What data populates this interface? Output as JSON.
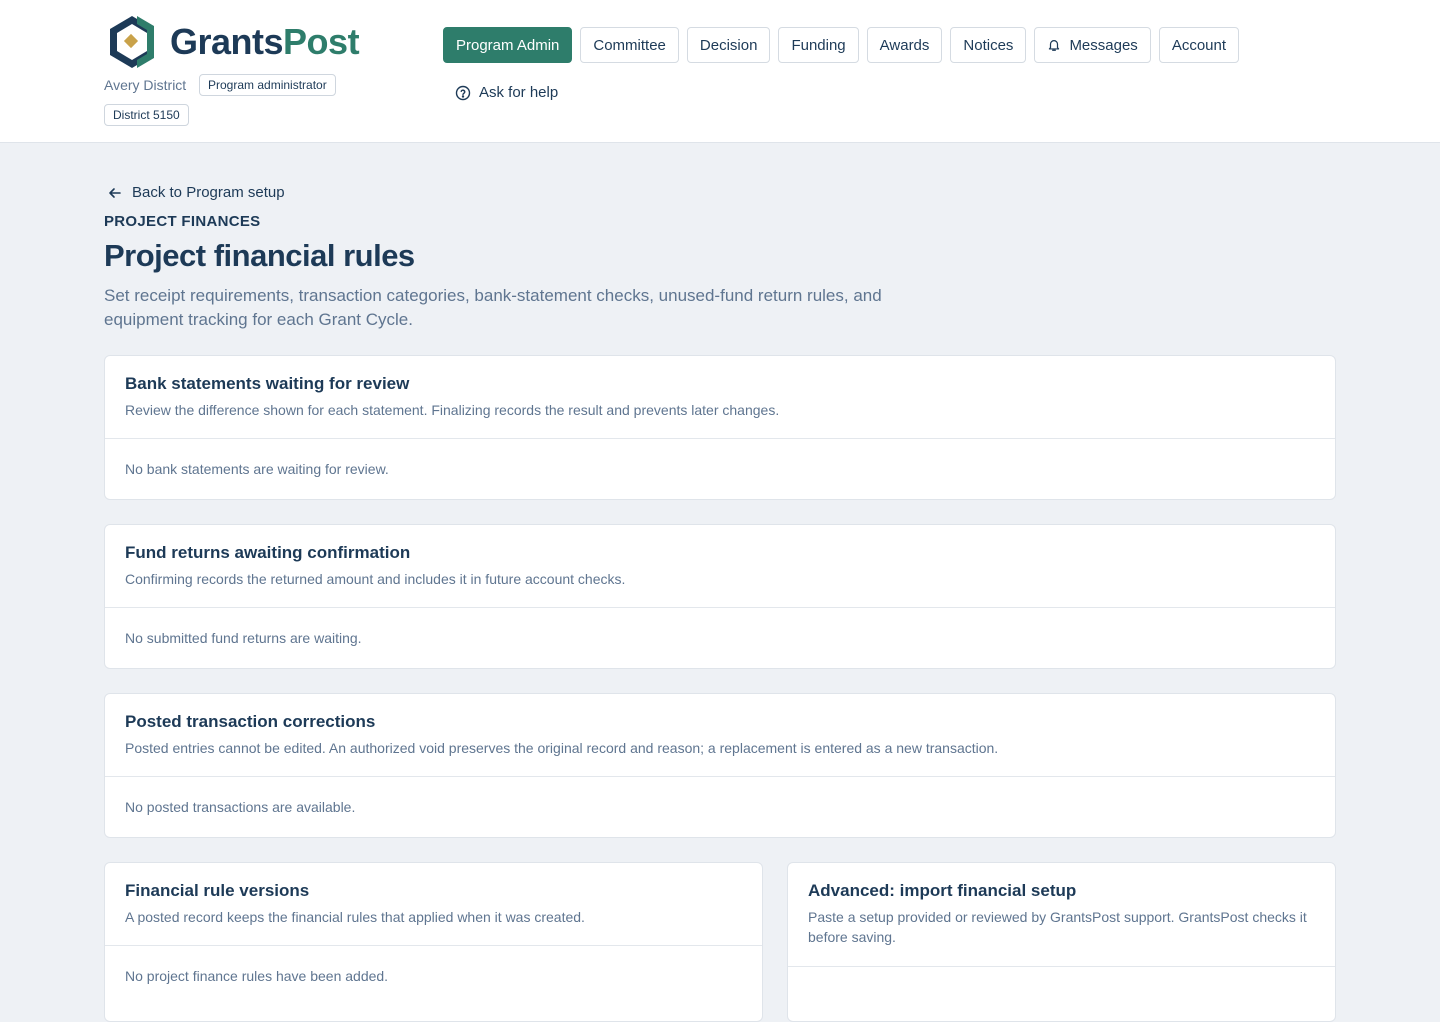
{
  "brand": {
    "name_part1": "Grants",
    "name_part2": "Post",
    "accent": "#2e7d6b"
  },
  "user": {
    "org": "Avery District",
    "role": "Program administrator",
    "district": "District 5150"
  },
  "nav": {
    "items": [
      {
        "label": "Program Admin",
        "active": true
      },
      {
        "label": "Committee"
      },
      {
        "label": "Decision"
      },
      {
        "label": "Funding"
      },
      {
        "label": "Awards"
      },
      {
        "label": "Notices"
      },
      {
        "label": "Messages",
        "icon": "bell-icon"
      },
      {
        "label": "Account"
      }
    ],
    "help": "Ask for help"
  },
  "page": {
    "back": "Back to Program setup",
    "eyebrow": "PROJECT FINANCES",
    "title": "Project financial rules",
    "subtitle": "Set receipt requirements, transaction categories, bank-statement checks, unused-fund return rules, and equipment tracking for each Grant Cycle."
  },
  "cards": [
    {
      "title": "Bank statements waiting for review",
      "desc": "Review the difference shown for each statement. Finalizing records the result and prevents later changes.",
      "empty": "No bank statements are waiting for review."
    },
    {
      "title": "Fund returns awaiting confirmation",
      "desc": "Confirming records the returned amount and includes it in future account checks.",
      "empty": "No submitted fund returns are waiting."
    },
    {
      "title": "Posted transaction corrections",
      "desc": "Posted entries cannot be edited. An authorized void preserves the original record and reason; a replacement is entered as a new transaction.",
      "empty": "No posted transactions are available."
    },
    {
      "title": "Financial rule versions",
      "desc": "A posted record keeps the financial rules that applied when it was created.",
      "empty": "No project finance rules have been added."
    },
    {
      "title": "Advanced: import financial setup",
      "desc": "Paste a setup provided or reviewed by GrantsPost support. GrantsPost checks it before saving."
    }
  ]
}
